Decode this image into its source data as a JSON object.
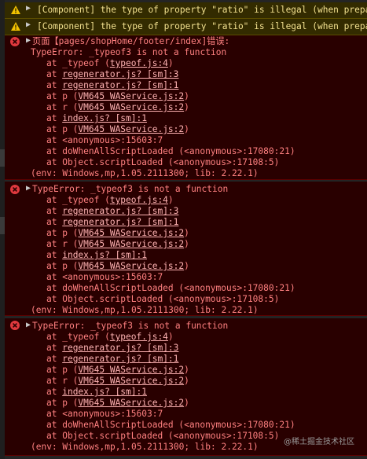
{
  "warnings": [
    {
      "text": "[Component] the type of property \"ratio\" is illegal (when preparing"
    },
    {
      "text": "[Component] the type of property \"ratio\" is illegal (when preparing"
    }
  ],
  "errors": [
    {
      "header_prefix": "页面【",
      "header_page": "pages/shopHome/footer/index",
      "header_suffix": "]错误:",
      "message": "TypeError: _typeof3 is not a function",
      "stack": [
        {
          "pre": "at _typeof (",
          "link": "typeof.js:4",
          "post": ")"
        },
        {
          "pre": "at ",
          "link": "regenerator.js? [sm]:3",
          "post": ""
        },
        {
          "pre": "at ",
          "link": "regenerator.js? [sm]:1",
          "post": ""
        },
        {
          "pre": "at p (",
          "link": "VM645 WAService.js:2",
          "post": ")"
        },
        {
          "pre": "at r (",
          "link": "VM645 WAService.js:2",
          "post": ")"
        },
        {
          "pre": "at ",
          "link": "index.js? [sm]:1",
          "post": ""
        },
        {
          "pre": "at p (",
          "link": "VM645 WAService.js:2",
          "post": ")"
        },
        {
          "pre": "at <anonymous>:15603:7",
          "link": "",
          "post": ""
        },
        {
          "pre": "at doWhenAllScriptLoaded (<anonymous>:17080:21)",
          "link": "",
          "post": ""
        },
        {
          "pre": "at Object.scriptLoaded (<anonymous>:17108:5)",
          "link": "",
          "post": ""
        }
      ],
      "env": "(env: Windows,mp,1.05.2111300; lib: 2.22.1)"
    },
    {
      "message": "TypeError: _typeof3 is not a function",
      "stack": [
        {
          "pre": "at _typeof (",
          "link": "typeof.js:4",
          "post": ")"
        },
        {
          "pre": "at ",
          "link": "regenerator.js? [sm]:3",
          "post": ""
        },
        {
          "pre": "at ",
          "link": "regenerator.js? [sm]:1",
          "post": ""
        },
        {
          "pre": "at p (",
          "link": "VM645 WAService.js:2",
          "post": ")"
        },
        {
          "pre": "at r (",
          "link": "VM645 WAService.js:2",
          "post": ")"
        },
        {
          "pre": "at ",
          "link": "index.js? [sm]:1",
          "post": ""
        },
        {
          "pre": "at p (",
          "link": "VM645 WAService.js:2",
          "post": ")"
        },
        {
          "pre": "at <anonymous>:15603:7",
          "link": "",
          "post": ""
        },
        {
          "pre": "at doWhenAllScriptLoaded (<anonymous>:17080:21)",
          "link": "",
          "post": ""
        },
        {
          "pre": "at Object.scriptLoaded (<anonymous>:17108:5)",
          "link": "",
          "post": ""
        }
      ],
      "env": "(env: Windows,mp,1.05.2111300; lib: 2.22.1)"
    },
    {
      "message": "TypeError: _typeof3 is not a function",
      "stack": [
        {
          "pre": "at _typeof (",
          "link": "typeof.js:4",
          "post": ")"
        },
        {
          "pre": "at ",
          "link": "regenerator.js? [sm]:3",
          "post": ""
        },
        {
          "pre": "at ",
          "link": "regenerator.js? [sm]:1",
          "post": ""
        },
        {
          "pre": "at p (",
          "link": "VM645 WAService.js:2",
          "post": ")"
        },
        {
          "pre": "at r (",
          "link": "VM645 WAService.js:2",
          "post": ")"
        },
        {
          "pre": "at ",
          "link": "index.js? [sm]:1",
          "post": ""
        },
        {
          "pre": "at p (",
          "link": "VM645 WAService.js:2",
          "post": ")"
        },
        {
          "pre": "at <anonymous>:15603:7",
          "link": "",
          "post": ""
        },
        {
          "pre": "at doWhenAllScriptLoaded (<anonymous>:17080:21)",
          "link": "",
          "post": ""
        },
        {
          "pre": "at Object.scriptLoaded (<anonymous>:17108:5)",
          "link": "",
          "post": ""
        }
      ],
      "env": "(env: Windows,mp,1.05.2111300; lib: 2.22.1)"
    }
  ],
  "watermark": "@稀土掘金技术社区",
  "colors": {
    "background": "#242424",
    "warning_bg": "#332b00",
    "warning_text": "#f2e08f",
    "error_bg": "#290000",
    "error_text": "#ff8080",
    "error_icon": "#e0393e",
    "warning_icon": "#f2c200"
  },
  "icons": [
    "warning-icon",
    "error-icon",
    "expand-arrow-icon"
  ]
}
